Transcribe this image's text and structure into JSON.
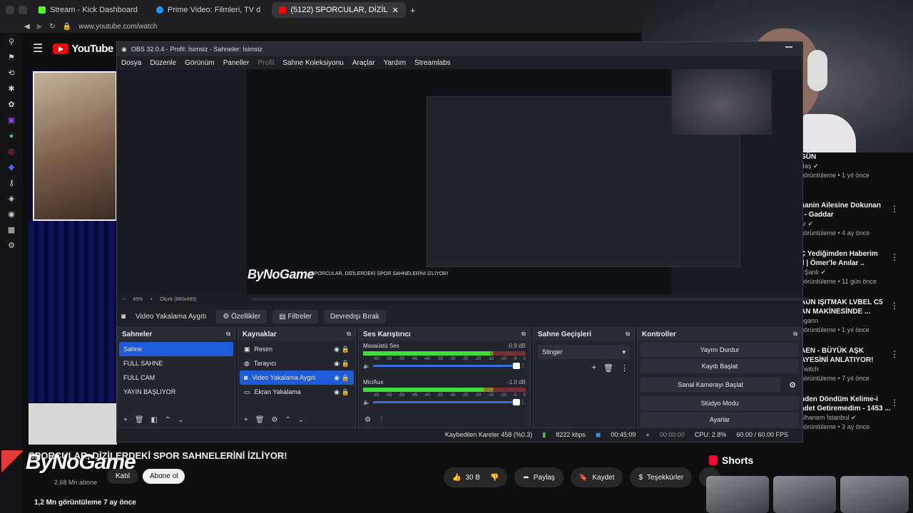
{
  "browser": {
    "tabs": [
      {
        "label": "Stream - Kick Dashboard",
        "fav": "#53fc18"
      },
      {
        "label": "Prime Video: Filmleri, TV d",
        "fav": "#1a98ff"
      },
      {
        "label": "(5122) SPORCULAR, DİZİL",
        "fav": "#ff0000",
        "active": true
      }
    ],
    "address": "www.youtube.com/watch"
  },
  "youtube": {
    "logo": "YouTube",
    "logo_sup": "TR",
    "video_title": "SPORCULAR, DİZİLERDEKİ SPOR SAHNELERİNİ İZLİYOR!",
    "channel_logo": "ByNoGame",
    "subscribers": "2,68 Mn abone",
    "join_label": "Katıl",
    "subscribe_label": "Abone ol",
    "likes": "30 B",
    "share_label": "Paylaş",
    "save_label": "Kaydet",
    "thanks_label": "Teşekkürler",
    "views_line": "1,2 Mn görüntüleme  7 ay önce",
    "shorts_label": "Shorts"
  },
  "recommendations": [
    {
      "title": "GÜN",
      "sub1": "Baş ✔",
      "sub2": "görüntüleme • 1 yıl önce"
    },
    {
      "title": "hanin Ailesine Dokunan\nl - Gaddar",
      "sub1": "ar ✔",
      "sub2": "görüntüleme • 4 ay önce"
    },
    {
      "title": "Ç Yediğimden Haberim\nll | Ömer'le Anılar ..",
      "sub1": "r Şanlı ✔",
      "sub2": "görüntüleme • 11 gün önce"
    },
    {
      "title": "AUN IŞITMAK LVBEL C5\nAN MAKİNESİNDE ...",
      "sub1": "ogann",
      "sub2": "görüntüleme • 1 yıl önce"
    },
    {
      "title": "AEN - BÜYÜK AŞK\nAYESİNİ ANLATIYOR!",
      "sub1": "Twitch",
      "sub2": "görüntüleme • 7 yıl önce"
    },
    {
      "title": "nden Döndüm Kelime-i\nadet Getiremedim - 1453 ...",
      "sub1": "alhanem İstanbul ✔",
      "sub2": "görüntüleme • 3 ay önce"
    }
  ],
  "obs": {
    "title": "OBS 32.0.4 - Profil: İsimsiz - Sahneler: İsimsiz",
    "menu": [
      "Dosya",
      "Düzenle",
      "Görünüm",
      "Paneller",
      "Profil",
      "Sahne Koleksiyonu",
      "Araçlar",
      "Yardım",
      "Streamlabs"
    ],
    "preview_logo": "ByNoGame",
    "preview_caption": "SPORCULAR, DİZİLERDEKİ SPOR SAHNELERİNİ İZLİYOR!",
    "zoom": "45%",
    "scale": "Ölçek (880x495)",
    "source_selected": "Video Yakalama Aygıtı",
    "btn_properties": "Özellikler",
    "btn_filters": "Filtreler",
    "btn_deactivate": "Devredışı Bırak",
    "docks": {
      "scenes_title": "Sahneler",
      "scenes": [
        "Sahne",
        "FULL SAHNE",
        "FULL CAM",
        "YAYIN BAŞLIYOR"
      ],
      "sources_title": "Kaynaklar",
      "sources": [
        "Resim",
        "Tarayıcı",
        "Video Yakalama Aygıtı",
        "Ekran Yakalama"
      ],
      "mixer_title": "Ses Karıştırıcı",
      "mixer": [
        {
          "name": "Masaüstü Ses",
          "db": "-0.9 dB",
          "level": 0.78
        },
        {
          "name": "Mic/Aux",
          "db": "-1.0 dB",
          "level": 0.74
        }
      ],
      "mixer_ticks": [
        "-60",
        "-55",
        "-50",
        "-45",
        "-40",
        "-35",
        "-30",
        "-25",
        "-20",
        "-15",
        "-10",
        "-5",
        "0"
      ],
      "transitions_title": "Sahne Geçişleri",
      "transition": "Stinger",
      "controls_title": "Kontroller",
      "controls": [
        "Yayını Durdur",
        "Kaydı Başlat",
        "Sanal Kamerayı Başlat",
        "Stüdyo Modu",
        "Ayarlar"
      ]
    },
    "status": {
      "dropped": "Kaybedilen Kareler 458 (%0.3)",
      "bitrate": "8222 kbps",
      "stream_time": "00:45:09",
      "rec_time": "00:00:00",
      "cpu": "CPU: 2.8%",
      "fps": "60.00 / 60.00 FPS"
    }
  },
  "colors": {
    "accent": "#1d5bd8",
    "yt_red": "#ff0000"
  }
}
